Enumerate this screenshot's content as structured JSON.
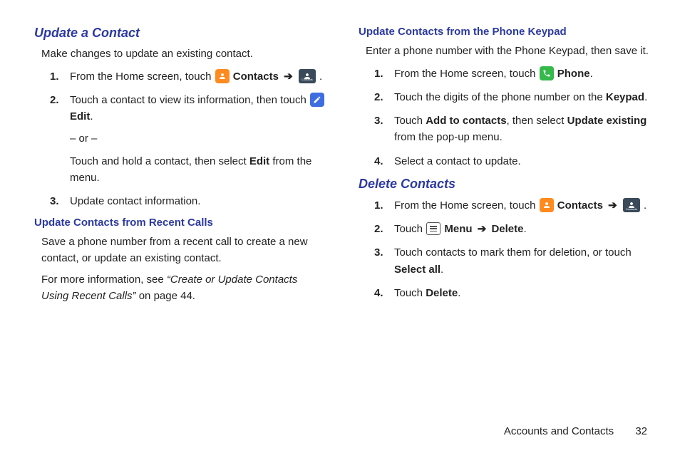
{
  "left": {
    "h_update": "Update a Contact",
    "p_intro": "Make changes to update an existing contact.",
    "steps": [
      {
        "num": "1.",
        "pre": "From the Home screen, touch ",
        "b1": "Contacts",
        "post": ".",
        "type": "iconline-contacts"
      },
      {
        "num": "2.",
        "pre": "Touch a contact to view its information, then touch ",
        "b1": "Edit",
        "post": ".",
        "or": "– or –",
        "sub_pre": "Touch and hold a contact, then select ",
        "sub_b": "Edit",
        "sub_post": " from the menu.",
        "type": "edit"
      },
      {
        "num": "3.",
        "text": "Update contact information.",
        "type": "plain"
      }
    ],
    "h_recent": "Update Contacts from Recent Calls",
    "p_recent1": "Save a phone number from a recent call to create a new contact, or update an existing contact.",
    "p_recent2_pre": "For more information, see ",
    "p_recent2_ref": "“Create or Update Contacts Using Recent Calls”",
    "p_recent2_post": " on page 44."
  },
  "right": {
    "h_keypad": "Update Contacts from the Phone Keypad",
    "p_keypad": "Enter a phone number with the Phone Keypad, then save it.",
    "steps_keypad": [
      {
        "num": "1.",
        "pre": "From the Home screen, touch ",
        "b1": "Phone",
        "post": ".",
        "type": "phone"
      },
      {
        "num": "2.",
        "pre": "Touch the digits of the phone number on the ",
        "b1": "Keypad",
        "post": ".",
        "type": "boldend"
      },
      {
        "num": "3.",
        "pre": "Touch ",
        "b1": "Add to contacts",
        "mid": ", then select ",
        "b2": "Update existing",
        "post": " from the pop-up menu.",
        "type": "double"
      },
      {
        "num": "4.",
        "text": "Select a contact to update.",
        "type": "plain"
      }
    ],
    "h_delete": "Delete Contacts",
    "steps_delete": [
      {
        "num": "1.",
        "pre": "From the Home screen, touch ",
        "b1": "Contacts",
        "post": ".",
        "type": "iconline-contacts"
      },
      {
        "num": "2.",
        "pre": "Touch ",
        "b1": "Menu",
        "b2": "Delete",
        "post": ".",
        "type": "menu"
      },
      {
        "num": "3.",
        "pre": "Touch contacts to mark them for deletion, or touch ",
        "b1": "Select all",
        "post": ".",
        "type": "boldend"
      },
      {
        "num": "4.",
        "pre": "Touch ",
        "b1": "Delete",
        "post": ".",
        "type": "boldend"
      }
    ]
  },
  "arrow": "➔",
  "footer": {
    "section": "Accounts and Contacts",
    "page": "32"
  }
}
